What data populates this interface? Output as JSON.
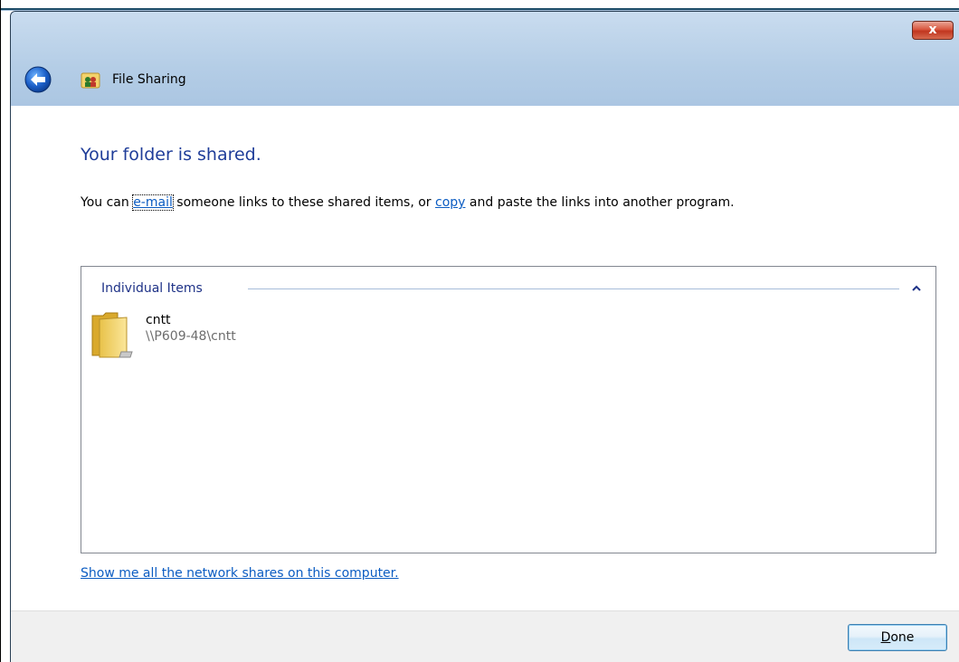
{
  "window": {
    "title": "File Sharing",
    "close_label": "x"
  },
  "content": {
    "heading": "Your folder is shared.",
    "description": {
      "prefix": "You can ",
      "email_link": "e-mail",
      "middle": " someone links to these shared items, or ",
      "copy_link": "copy",
      "suffix": " and paste the links into another program."
    },
    "group": {
      "label": "Individual Items",
      "items": [
        {
          "name": "cntt",
          "path": "\\\\P609-48\\cntt"
        }
      ]
    },
    "network_shares_link": "Show me all the network shares on this computer."
  },
  "footer": {
    "done_mnemonic": "D",
    "done_rest": "one"
  },
  "colors": {
    "heading": "#1f3d99",
    "link": "#0b5cc2",
    "group_label": "#1e3287",
    "titlebar": "#b4cde6",
    "footer": "#f0f0f0"
  }
}
